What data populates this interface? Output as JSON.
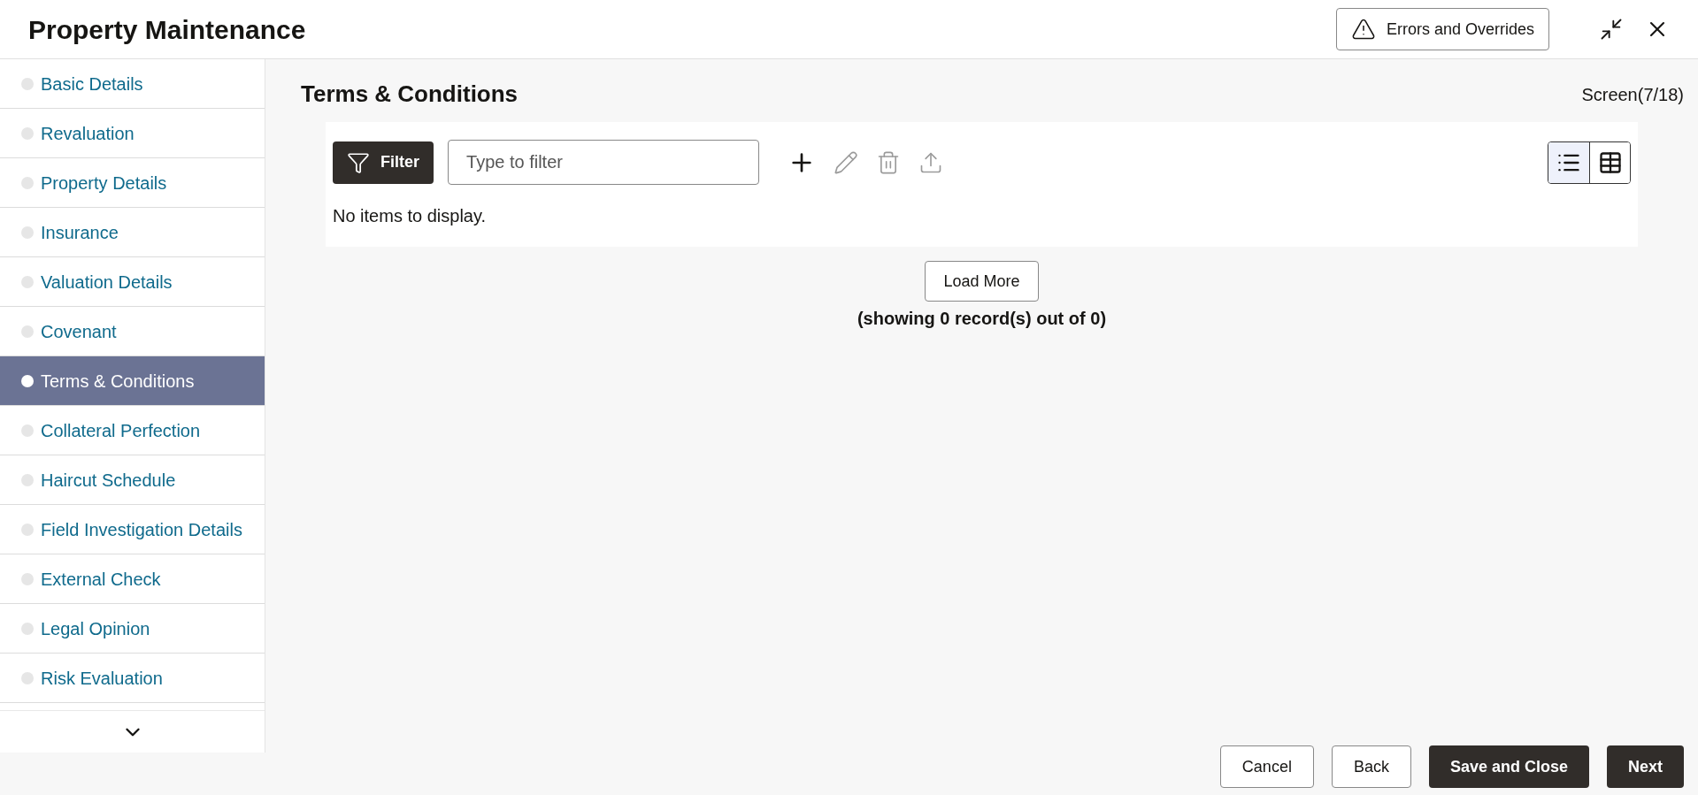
{
  "window": {
    "title": "Property Maintenance"
  },
  "header_actions": {
    "errors_button": "Errors and Overrides"
  },
  "sidebar": {
    "items": [
      {
        "label": "Basic Details",
        "selected": false
      },
      {
        "label": "Revaluation",
        "selected": false
      },
      {
        "label": "Property Details",
        "selected": false
      },
      {
        "label": "Insurance",
        "selected": false
      },
      {
        "label": "Valuation Details",
        "selected": false
      },
      {
        "label": "Covenant",
        "selected": false
      },
      {
        "label": "Terms & Conditions",
        "selected": true
      },
      {
        "label": "Collateral Perfection",
        "selected": false
      },
      {
        "label": "Haircut Schedule",
        "selected": false
      },
      {
        "label": "Field Investigation Details",
        "selected": false
      },
      {
        "label": "External Check",
        "selected": false
      },
      {
        "label": "Legal Opinion",
        "selected": false
      },
      {
        "label": "Risk Evaluation",
        "selected": false
      }
    ]
  },
  "section": {
    "title": "Terms & Conditions",
    "screen_counter": "Screen(7/18)"
  },
  "toolbar": {
    "filter_button": "Filter",
    "filter_field": {
      "placeholder": "Type to filter"
    },
    "actions": [
      {
        "kind": "add",
        "disabled": false
      },
      {
        "kind": "edit",
        "disabled": true
      },
      {
        "kind": "delete",
        "disabled": true
      },
      {
        "kind": "upload",
        "disabled": true
      }
    ],
    "views": [
      {
        "kind": "list",
        "selected": true
      },
      {
        "kind": "table",
        "selected": false
      }
    ]
  },
  "empty_message": "No items to display.",
  "load_more": {
    "button": "Load More",
    "summary": "(showing 0 record(s) out of 0)"
  },
  "footer_buttons": [
    {
      "label": "Cancel",
      "kind": "secondary"
    },
    {
      "label": "Back",
      "kind": "secondary"
    },
    {
      "label": "Save and Close",
      "kind": "primary"
    },
    {
      "label": "Next",
      "kind": "primary"
    }
  ]
}
